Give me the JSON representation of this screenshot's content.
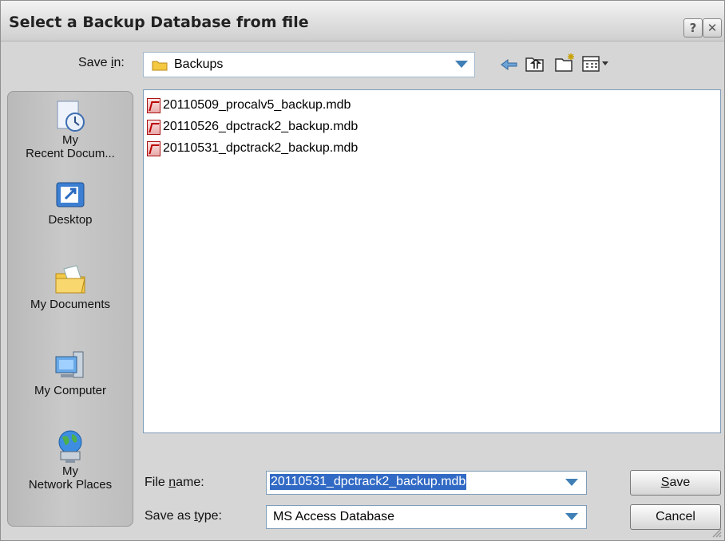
{
  "dialog": {
    "title": "Select a Backup Database from file",
    "help_glyph": "?",
    "close_glyph": "✕"
  },
  "save_in": {
    "label_pre": "Save ",
    "label_key": "i",
    "label_post": "n:",
    "value": "Backups"
  },
  "toolbar": {
    "icons": [
      "back-icon",
      "up-folder-icon",
      "new-folder-icon",
      "views-menu-icon"
    ]
  },
  "places": [
    {
      "line1": "My",
      "line2": "Recent Docum..."
    },
    {
      "line1": "Desktop",
      "line2": ""
    },
    {
      "line1": "My Documents",
      "line2": ""
    },
    {
      "line1": "My Computer",
      "line2": ""
    },
    {
      "line1": "My",
      "line2": "Network Places"
    }
  ],
  "files": [
    {
      "name": "20110509_procalv5_backup.mdb"
    },
    {
      "name": "20110526_dpctrack2_backup.mdb"
    },
    {
      "name": "20110531_dpctrack2_backup.mdb"
    }
  ],
  "file_name": {
    "label_pre": "File ",
    "label_key": "n",
    "label_post": "ame:",
    "value": "20110531_dpctrack2_backup.mdb"
  },
  "save_type": {
    "label_pre": "Save as ",
    "label_key": "t",
    "label_post": "ype:",
    "value": "MS Access Database"
  },
  "buttons": {
    "save_key": "S",
    "save_rest": "ave",
    "cancel": "Cancel"
  },
  "colors": {
    "selection": "#316ac5",
    "accent_arrow": "#3f7fb6",
    "folder": "#f5c842"
  }
}
